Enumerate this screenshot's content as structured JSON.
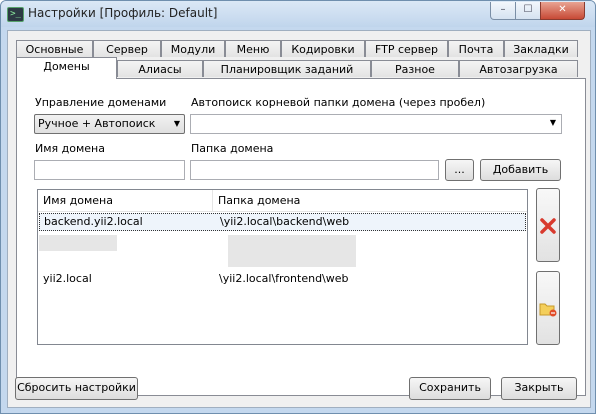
{
  "window": {
    "title": "Настройки [Профиль: Default]"
  },
  "tabs_row1": [
    "Основные",
    "Сервер",
    "Модули",
    "Меню",
    "Кодировки",
    "FTP сервер",
    "Почта",
    "Закладки"
  ],
  "tabs_row2": [
    "Домены",
    "Алиасы",
    "Планировщик заданий",
    "Разное",
    "Автозагрузка"
  ],
  "domain_mgmt": {
    "label": "Управление доменами",
    "value": "Ручное + Автопоиск"
  },
  "autosearch": {
    "label": "Автопоиск корневой папки домена (через пробел)",
    "value": ""
  },
  "domain_name": {
    "label": "Имя домена",
    "value": ""
  },
  "domain_folder": {
    "label": "Папка домена",
    "value": ""
  },
  "browse_label": "...",
  "add_label": "Добавить",
  "table": {
    "columns": [
      "Имя домена",
      "Папка домена"
    ],
    "rows": [
      {
        "name": "backend.yii2.local",
        "folder": "\\yii2.local\\backend\\web"
      },
      {
        "name": "yii2.local",
        "folder": "\\yii2.local\\frontend\\web"
      }
    ]
  },
  "footer": {
    "reset": "Сбросить настройки",
    "save": "Сохранить",
    "close": "Закрыть"
  },
  "icons": {
    "delete": "delete-x-icon",
    "add_folder": "folder-add-icon"
  }
}
